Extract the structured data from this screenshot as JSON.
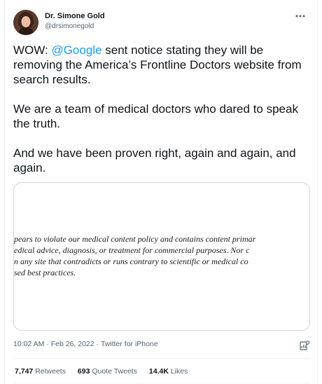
{
  "author": {
    "display_name": "Dr. Simone Gold",
    "handle": "@drsimonegold"
  },
  "tweet": {
    "p1_prefix": "WOW: ",
    "p1_mention": "@Google",
    "p1_suffix": " sent notice stating they will be removing the America’s Frontline Doctors website from search results.",
    "p2": "We are a team of medical doctors who dared to speak the truth.",
    "p3": "And we have been proven right, again and again, and again."
  },
  "media": {
    "lines": [
      "pears to violate our medical content policy and contains content primar",
      "edical advice, diagnosis, or treatment for commercial purposes. Nor c",
      "n any site that contradicts or runs contrary to scientific or medical co",
      "sed best practices."
    ]
  },
  "meta": {
    "time": "10:02 AM",
    "sep1": " · ",
    "date": "Feb 26, 2022",
    "sep2": " · ",
    "source": "Twitter for iPhone"
  },
  "stats": {
    "retweets_count": "7,747",
    "retweets_label": "Retweets",
    "quotes_count": "693",
    "quotes_label": "Quote Tweets",
    "likes_count": "14.4K",
    "likes_label": "Likes"
  },
  "colors": {
    "accent": "#1d9bf0",
    "text": "#0f1419",
    "secondary": "#536471",
    "border": "#cfd9de"
  },
  "icons": [
    "more-icon",
    "analytics-icon"
  ]
}
